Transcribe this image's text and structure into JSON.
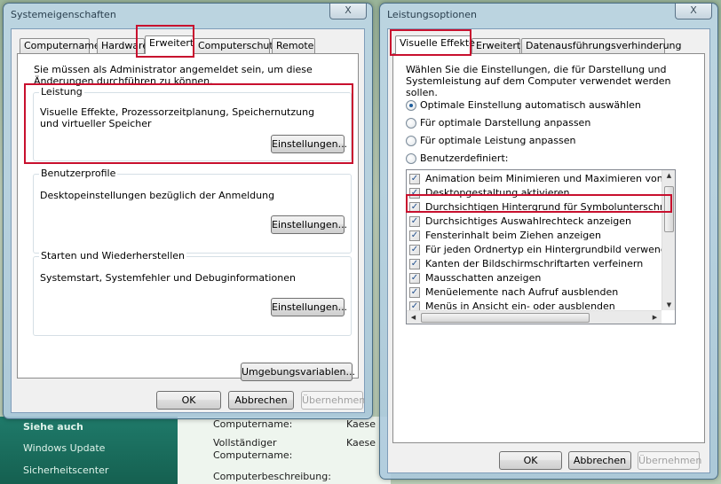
{
  "background": {
    "sidebar_links": [
      "Siehe auch",
      "Windows Update",
      "Sicherheitscenter"
    ],
    "fields": [
      {
        "label": "Computername:",
        "value": "Kaese"
      },
      {
        "label": "Vollständiger Computername:",
        "value": "Kaese"
      },
      {
        "label": "Computerbeschreibung:",
        "value": ""
      }
    ]
  },
  "system_dialog": {
    "title": "Systemeigenschaften",
    "close_label": "X",
    "tabs": [
      "Computername",
      "Hardware",
      "Erweitert",
      "Computerschutz",
      "Remote"
    ],
    "active_tab": "Erweitert",
    "admin_note": "Sie müssen als Administrator angemeldet sein, um diese Änderungen durchführen zu können.",
    "groups": [
      {
        "label": "Leistung",
        "description": "Visuelle Effekte, Prozessorzeitplanung, Speichernutzung und virtueller Speicher",
        "button": "Einstellungen..."
      },
      {
        "label": "Benutzerprofile",
        "description": "Desktopeinstellungen bezüglich der Anmeldung",
        "button": "Einstellungen..."
      },
      {
        "label": "Starten und Wiederherstellen",
        "description": "Systemstart, Systemfehler und Debuginformationen",
        "button": "Einstellungen..."
      }
    ],
    "env_button": "Umgebungsvariablen...",
    "ok": "OK",
    "cancel": "Abbrechen",
    "apply": "Übernehmen"
  },
  "performance_dialog": {
    "title": "Leistungsoptionen",
    "close_label": "X",
    "tabs": [
      "Visuelle Effekte",
      "Erweitert",
      "Datenausführungsverhinderung"
    ],
    "active_tab": "Visuelle Effekte",
    "intro": "Wählen Sie die Einstellungen, die für Darstellung und Systemleistung auf dem Computer verwendet werden sollen.",
    "radios": [
      {
        "label": "Optimale Einstellung automatisch auswählen",
        "checked": true
      },
      {
        "label": "Für optimale Darstellung anpassen",
        "checked": false
      },
      {
        "label": "Für optimale Leistung anpassen",
        "checked": false
      },
      {
        "label": "Benutzerdefiniert:",
        "checked": false
      }
    ],
    "effects": [
      {
        "label": "Animation beim Minimieren und Maximieren von Fenstern",
        "checked": true
      },
      {
        "label": "Desktopgestaltung aktivieren",
        "checked": true
      },
      {
        "label": "Durchsichtigen Hintergrund für Symbolunterschriften auf d",
        "checked": true
      },
      {
        "label": "Durchsichtiges Auswahlrechteck anzeigen",
        "checked": true
      },
      {
        "label": "Fensterinhalt beim Ziehen anzeigen",
        "checked": true
      },
      {
        "label": "Für jeden Ordnertyp ein Hintergrundbild verwenden",
        "checked": true
      },
      {
        "label": "Kanten der Bildschirmschriftarten verfeinern",
        "checked": true
      },
      {
        "label": "Mausschatten anzeigen",
        "checked": true
      },
      {
        "label": "Menüelemente nach Aufruf ausblenden",
        "checked": true
      },
      {
        "label": "Menüs in Ansicht ein- oder ausblenden",
        "checked": true
      }
    ],
    "ok": "OK",
    "cancel": "Abbrechen",
    "apply": "Übernehmen"
  },
  "colors": {
    "highlight": "#c8102e",
    "check": "#1f4e8c"
  }
}
